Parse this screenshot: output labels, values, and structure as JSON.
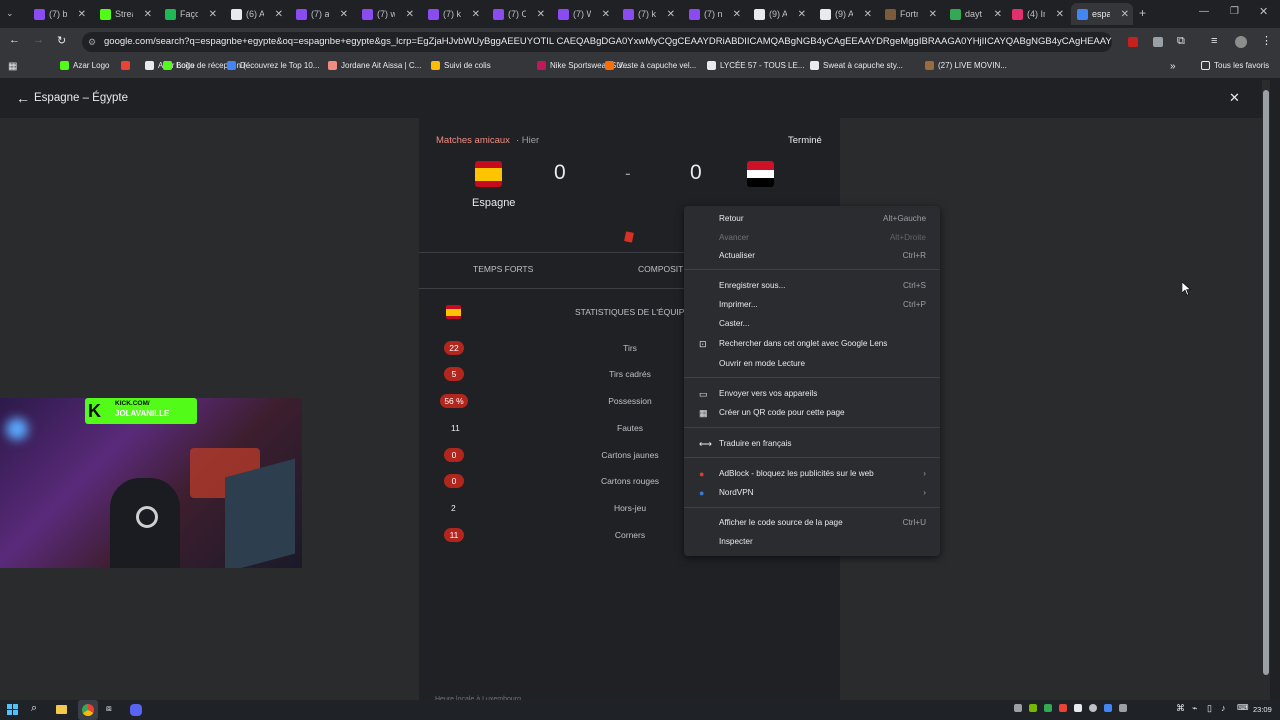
{
  "tabs": [
    "(7) b",
    "Strea",
    "Faço",
    "(6) A",
    "(7) ai",
    "(7) w",
    "(7) ki",
    "(7) C",
    "(7) W",
    "(7) ki",
    "(7) n",
    "(9) A",
    "(9) A",
    "Fortn",
    "dayt",
    "(4) In",
    "espa"
  ],
  "url": "google.com/search?q=espagnbe+egypte&oq=espagnbe+egypte&gs_lcrp=EgZjaHJvbWUyBggAEEUYOTIL CAEQABgDGA0YxwMyCQgCEAAYDRiABDIICAMQABgNGB4yCAgEEAAYDRgeMggIBRAAGA0YHjIICAYQABgNGB4yCAgHEAAYDRgeM...",
  "bookmarks": [
    "Azar Logo",
    "",
    "Azar Logo",
    "Boîte de réception (...",
    "Découvrez le Top 10...",
    "Jordane Ait Aissa | C...",
    "Suivi de colis",
    "Nike Sportswear SU...",
    "Veste à capuche vel...",
    "LYCÉE 57 - TOUS LE...",
    "Sweat à capuche sty...",
    "(27) LIVE MOVIN..."
  ],
  "all_bookmarks": "Tous les favoris",
  "header": {
    "back_icon": "arrow-left-icon",
    "title": "Espagne – Égypte",
    "close": "✕"
  },
  "match": {
    "competition": "Matches amicaux",
    "when": "· Hier",
    "status": "Terminé",
    "home_team": "Espagne",
    "home_score": "0",
    "separator": "-",
    "away_score": "0",
    "away_team": "Égypte"
  },
  "tabs_bottom": [
    "TEMPS FORTS",
    "COMPOSITI"
  ],
  "stats_title": "STATISTIQUES DE L'ÉQUIPE",
  "stats": [
    {
      "label": "Tirs",
      "home": "22",
      "badge": true
    },
    {
      "label": "Tirs cadrés",
      "home": "5",
      "badge": true
    },
    {
      "label": "Possession",
      "home": "56 %",
      "badge": true
    },
    {
      "label": "Fautes",
      "home": "11",
      "badge": false
    },
    {
      "label": "Cartons jaunes",
      "home": "0",
      "badge": true
    },
    {
      "label": "Cartons rouges",
      "home": "0",
      "badge": true
    },
    {
      "label": "Hors-jeu",
      "home": "2",
      "badge": false
    },
    {
      "label": "Corners",
      "home": "11",
      "badge": true
    }
  ],
  "menu": {
    "items": [
      {
        "label": "Retour",
        "shortcut": "Alt+Gauche"
      },
      {
        "label": "Avancer",
        "shortcut": "Alt+Droite",
        "disabled": true
      },
      {
        "label": "Actualiser",
        "shortcut": "Ctrl+R"
      },
      {
        "label": "Enregistrer sous...",
        "shortcut": "Ctrl+S"
      },
      {
        "label": "Imprimer...",
        "shortcut": "Ctrl+P"
      },
      {
        "label": "Caster...",
        "shortcut": ""
      },
      {
        "label": "Rechercher dans cet onglet avec Google Lens",
        "shortcut": ""
      },
      {
        "label": "Ouvrir en mode Lecture",
        "shortcut": ""
      },
      {
        "label": "Envoyer vers vos appareils",
        "shortcut": ""
      },
      {
        "label": "Créer un QR code pour cette page",
        "shortcut": ""
      },
      {
        "label": "Traduire en français",
        "shortcut": ""
      },
      {
        "label": "AdBlock - bloquez les publicités sur le web",
        "shortcut": "›"
      },
      {
        "label": "NordVPN",
        "shortcut": "›"
      },
      {
        "label": "Afficher le code source de la page",
        "shortcut": "Ctrl+U"
      },
      {
        "label": "Inspecter",
        "shortcut": ""
      }
    ]
  },
  "webcam": {
    "line1": "KICK.COM/",
    "line2": "JOLAVANILLE"
  },
  "footer_note": "Heure locale à Luxembourg",
  "clock": "23:09",
  "colors": {
    "accent_red": "#b3261e",
    "kick_green": "#53fc18"
  }
}
